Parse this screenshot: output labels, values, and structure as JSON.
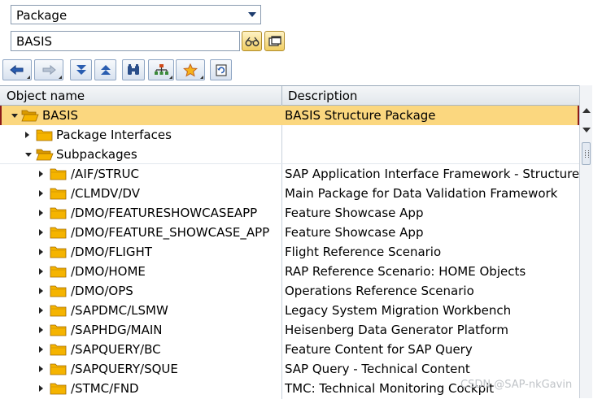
{
  "selector": {
    "value": "Package"
  },
  "search": {
    "value": "BASIS"
  },
  "search_buttons": [
    {
      "icon": "glasses-icon"
    },
    {
      "icon": "window-icon"
    }
  ],
  "toolbar": [
    {
      "icon": "back-arrow-icon",
      "menu": true
    },
    {
      "icon": "forward-arrow-icon",
      "menu": true
    },
    {
      "icon": "expand-down-icon",
      "menu": false
    },
    {
      "icon": "collapse-up-icon",
      "menu": false
    },
    {
      "icon": "binoculars-icon",
      "menu": false
    },
    {
      "icon": "hierarchy-icon",
      "menu": true
    },
    {
      "icon": "favorites-star-icon",
      "menu": true
    },
    {
      "icon": "refresh-icon",
      "menu": false
    }
  ],
  "table": {
    "headers": {
      "name": "Object name",
      "description": "Description"
    },
    "rows": [
      {
        "level": 0,
        "expander": "down",
        "folder": true,
        "name": "BASIS",
        "desc": "BASIS Structure Package",
        "selected": true
      },
      {
        "level": 1,
        "expander": "right",
        "folder": true,
        "name": "Package Interfaces",
        "desc": ""
      },
      {
        "level": 1,
        "expander": "down",
        "folder": true,
        "open": true,
        "name": "Subpackages",
        "desc": ""
      },
      {
        "level": 2,
        "expander": "right",
        "folder": true,
        "name": "/AIF/STRUC",
        "desc": "SAP Application Interface Framework - Structure Pa"
      },
      {
        "level": 2,
        "expander": "right",
        "folder": true,
        "name": "/CLMDV/DV",
        "desc": "Main Package for Data Validation Framework"
      },
      {
        "level": 2,
        "expander": "right",
        "folder": true,
        "name": "/DMO/FEATURESHOWCASEAPP",
        "desc": "Feature Showcase App"
      },
      {
        "level": 2,
        "expander": "right",
        "folder": true,
        "name": "/DMO/FEATURE_SHOWCASE_APP",
        "desc": "Feature Showcase App"
      },
      {
        "level": 2,
        "expander": "right",
        "folder": true,
        "name": "/DMO/FLIGHT",
        "desc": "Flight Reference Scenario"
      },
      {
        "level": 2,
        "expander": "right",
        "folder": true,
        "name": "/DMO/HOME",
        "desc": "RAP Reference Scenario: HOME Objects"
      },
      {
        "level": 2,
        "expander": "right",
        "folder": true,
        "name": "/DMO/OPS",
        "desc": "Operations Reference Scenario"
      },
      {
        "level": 2,
        "expander": "right",
        "folder": true,
        "name": "/SAPDMC/LSMW",
        "desc": "Legacy System Migration Workbench"
      },
      {
        "level": 2,
        "expander": "right",
        "folder": true,
        "name": "/SAPHDG/MAIN",
        "desc": "Heisenberg Data Generator Platform"
      },
      {
        "level": 2,
        "expander": "right",
        "folder": true,
        "name": "/SAPQUERY/BC",
        "desc": "Feature Content for SAP Query"
      },
      {
        "level": 2,
        "expander": "right",
        "folder": true,
        "name": "/SAPQUERY/SQUE",
        "desc": "SAP Query - Technical Content"
      },
      {
        "level": 2,
        "expander": "right",
        "folder": true,
        "name": "/STMC/FND",
        "desc": "TMC: Technical Monitoring Cockpit"
      }
    ]
  },
  "watermark": "CSDN @SAP-nkGavin",
  "colors": {
    "selection": "#fbd77f",
    "folder": "#f5b400",
    "accent": "#1d3c6e"
  }
}
